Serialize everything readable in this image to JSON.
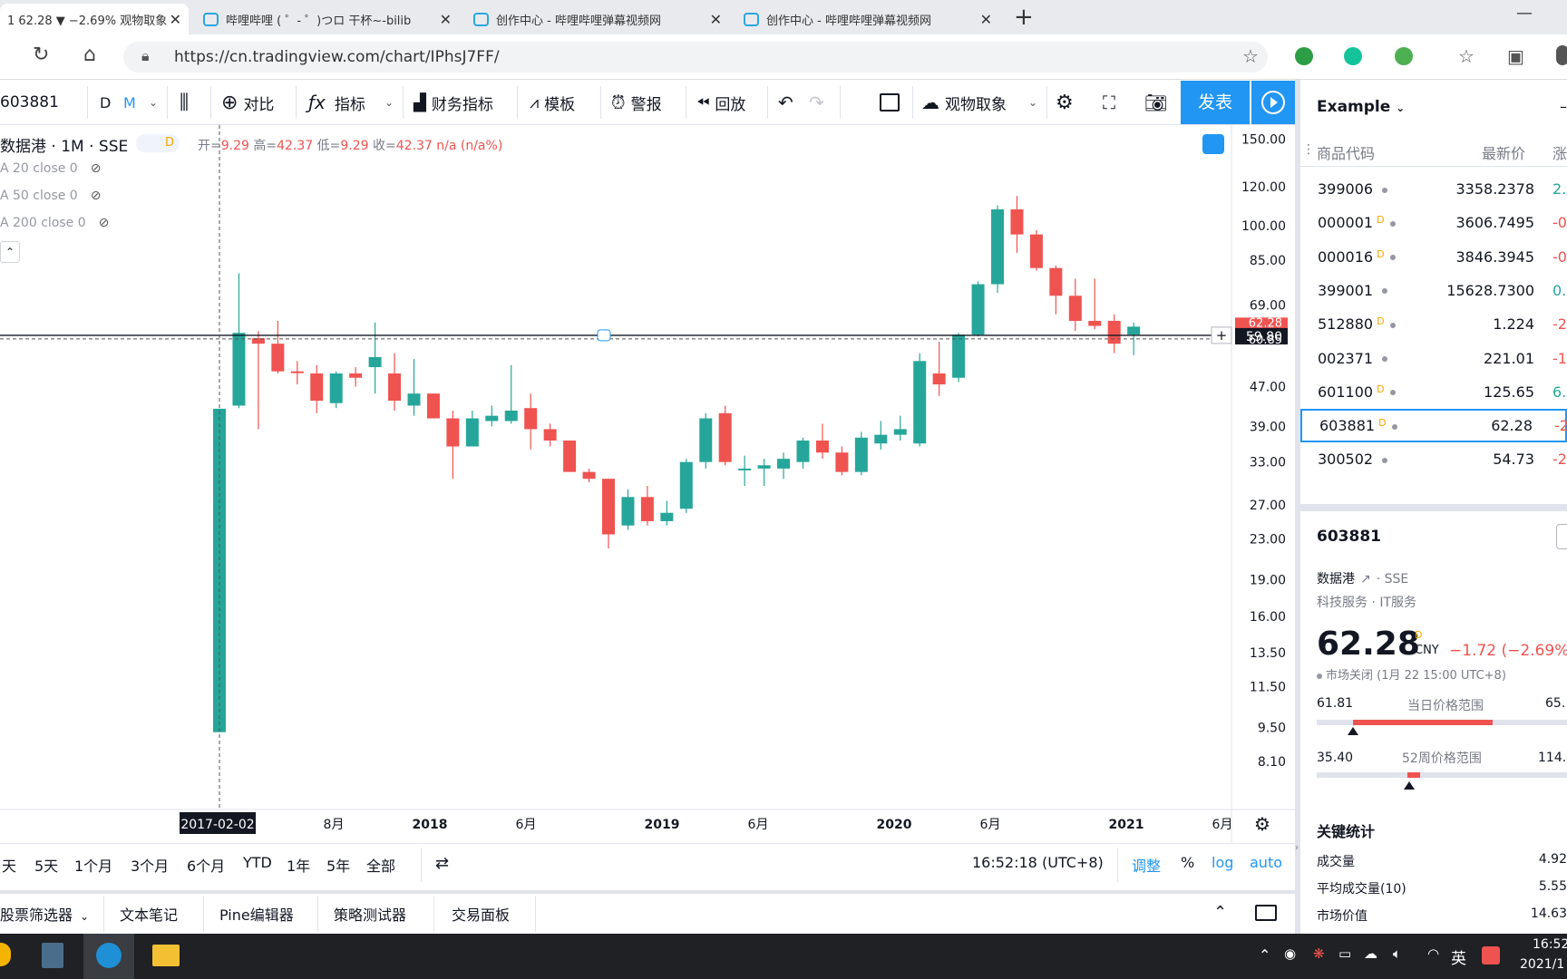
{
  "browser": {
    "tabs": [
      {
        "title": "1 62.28 ▼ −2.69% 观物取象"
      },
      {
        "title": "哔哩哔哩 ( ゜- ゜)つロ 干杯~-bilib"
      },
      {
        "title": "创作中心 - 哔哩哔哩弹幕视频网"
      },
      {
        "title": "创作中心 - 哔哩哔哩弹幕视频网"
      }
    ],
    "new_tab": "+",
    "url": "https://cn.tradingview.com/chart/IPhsJ7FF/"
  },
  "toolbar": {
    "symbol": "603881",
    "interval_d": "D",
    "interval_m": "M",
    "compare": "对比",
    "indicators": "指标",
    "financials": "财务指标",
    "templates": "模板",
    "alerts": "警报",
    "replay": "回放",
    "layout_name": "观物取象",
    "publish": "发表"
  },
  "chart_header": {
    "title": "数据港 · 1M · SSE",
    "d_badge": "D",
    "ohlc_open_label": "开=",
    "ohlc_open": "9.29",
    "ohlc_high_label": "高=",
    "ohlc_high": "42.37",
    "ohlc_low_label": "低=",
    "ohlc_low": "9.29",
    "ohlc_close_label": "收=",
    "ohlc_close": "42.37 n/a (n/a%)",
    "indicators": [
      "A 20 close 0",
      "A 50 close 0",
      "A 200 close 0"
    ]
  },
  "chart_data": {
    "type": "candlestick",
    "title": "数据港 · 1M · SSE",
    "log_scale": true,
    "ylim": [
      7.5,
      155
    ],
    "y_ticks": [
      150.0,
      120.0,
      100.0,
      85.0,
      69.0,
      47.0,
      39.0,
      33.0,
      27.0,
      23.0,
      19.0,
      16.0,
      13.5,
      11.5,
      9.5,
      8.1
    ],
    "x_labels": [
      "2017-02-02",
      "8月",
      "2018",
      "6月",
      "2019",
      "6月",
      "2020",
      "6月",
      "2021",
      "6月"
    ],
    "crosshair_price": "59.80",
    "last_price_label": "62.28",
    "prev_close_label": "60.85",
    "candles": [
      {
        "o": 9.29,
        "h": 42.37,
        "l": 9.29,
        "c": 42.37
      },
      {
        "o": 43.0,
        "h": 80.0,
        "l": 42.5,
        "c": 60.5
      },
      {
        "o": 59.0,
        "h": 61.0,
        "l": 38.5,
        "c": 57.5
      },
      {
        "o": 57.5,
        "h": 64.0,
        "l": 50.0,
        "c": 50.5
      },
      {
        "o": 50.5,
        "h": 53.0,
        "l": 47.5,
        "c": 50.3
      },
      {
        "o": 50.0,
        "h": 52.0,
        "l": 41.5,
        "c": 44.0
      },
      {
        "o": 43.5,
        "h": 50.5,
        "l": 42.5,
        "c": 50.0
      },
      {
        "o": 50.0,
        "h": 51.5,
        "l": 47.0,
        "c": 49.0
      },
      {
        "o": 51.5,
        "h": 63.5,
        "l": 45.5,
        "c": 54.0
      },
      {
        "o": 50.0,
        "h": 55.0,
        "l": 42.0,
        "c": 44.0
      },
      {
        "o": 43.0,
        "h": 53.5,
        "l": 41.0,
        "c": 45.5
      },
      {
        "o": 45.5,
        "h": 45.5,
        "l": 40.5,
        "c": 40.5
      },
      {
        "o": 40.5,
        "h": 42.0,
        "l": 30.5,
        "c": 35.5
      },
      {
        "o": 35.5,
        "h": 42.0,
        "l": 35.5,
        "c": 40.5
      },
      {
        "o": 40.0,
        "h": 43.0,
        "l": 39.0,
        "c": 41.0
      },
      {
        "o": 40.0,
        "h": 52.0,
        "l": 39.5,
        "c": 42.0
      },
      {
        "o": 42.5,
        "h": 45.5,
        "l": 35.0,
        "c": 38.5
      },
      {
        "o": 38.5,
        "h": 39.5,
        "l": 35.5,
        "c": 36.5
      },
      {
        "o": 36.5,
        "h": 36.5,
        "l": 31.5,
        "c": 31.5
      },
      {
        "o": 31.5,
        "h": 32.0,
        "l": 30.0,
        "c": 30.5
      },
      {
        "o": 30.5,
        "h": 30.5,
        "l": 22.0,
        "c": 23.5
      },
      {
        "o": 24.5,
        "h": 29.0,
        "l": 24.0,
        "c": 28.0
      },
      {
        "o": 28.0,
        "h": 29.5,
        "l": 24.5,
        "c": 25.0
      },
      {
        "o": 25.0,
        "h": 27.5,
        "l": 24.5,
        "c": 26.0
      },
      {
        "o": 26.5,
        "h": 33.5,
        "l": 26.0,
        "c": 33.0
      },
      {
        "o": 33.0,
        "h": 41.5,
        "l": 32.0,
        "c": 40.5
      },
      {
        "o": 41.5,
        "h": 43.0,
        "l": 32.5,
        "c": 33.0
      },
      {
        "o": 32.0,
        "h": 34.0,
        "l": 29.5,
        "c": 32.0
      },
      {
        "o": 32.0,
        "h": 33.5,
        "l": 29.5,
        "c": 32.5
      },
      {
        "o": 32.0,
        "h": 34.5,
        "l": 30.5,
        "c": 33.5
      },
      {
        "o": 33.0,
        "h": 37.0,
        "l": 32.0,
        "c": 36.5
      },
      {
        "o": 36.5,
        "h": 39.5,
        "l": 33.5,
        "c": 34.5
      },
      {
        "o": 34.5,
        "h": 35.5,
        "l": 31.0,
        "c": 31.5
      },
      {
        "o": 31.5,
        "h": 38.0,
        "l": 31.0,
        "c": 37.0
      },
      {
        "o": 36.0,
        "h": 40.0,
        "l": 35.0,
        "c": 37.5
      },
      {
        "o": 37.5,
        "h": 41.0,
        "l": 36.5,
        "c": 38.5
      },
      {
        "o": 36.0,
        "h": 55.0,
        "l": 35.5,
        "c": 53.0
      },
      {
        "o": 50.0,
        "h": 58.0,
        "l": 45.0,
        "c": 47.5
      },
      {
        "o": 49.0,
        "h": 60.5,
        "l": 48.0,
        "c": 60.0
      },
      {
        "o": 60.0,
        "h": 77.0,
        "l": 59.5,
        "c": 76.0
      },
      {
        "o": 76.0,
        "h": 110.0,
        "l": 73.0,
        "c": 108.0
      },
      {
        "o": 108.0,
        "h": 115.0,
        "l": 88.0,
        "c": 96.0
      },
      {
        "o": 96.0,
        "h": 98.0,
        "l": 81.0,
        "c": 82.0
      },
      {
        "o": 82.0,
        "h": 83.0,
        "l": 66.0,
        "c": 72.0
      },
      {
        "o": 72.0,
        "h": 78.0,
        "l": 61.0,
        "c": 64.0
      },
      {
        "o": 64.0,
        "h": 78.0,
        "l": 61.5,
        "c": 62.5
      },
      {
        "o": 64.0,
        "h": 66.0,
        "l": 55.0,
        "c": 57.5
      },
      {
        "o": 60.0,
        "h": 63.5,
        "l": 54.5,
        "c": 62.28
      }
    ]
  },
  "range_bar": {
    "ranges": [
      "天",
      "5天",
      "1个月",
      "3个月",
      "6个月",
      "YTD",
      "1年",
      "5年",
      "全部"
    ],
    "time": "16:52:18 (UTC+8)",
    "adjust": "调整",
    "percent": "%",
    "log": "log",
    "auto": "auto"
  },
  "bottom_tabs": [
    "股票筛选器",
    "文本笔记",
    "Pine编辑器",
    "策略测试器",
    "交易面板"
  ],
  "watchlist": {
    "name": "Example",
    "col_symbol": "商品代码",
    "col_price": "最新价",
    "col_change": "涨",
    "rows": [
      {
        "sym": "399006",
        "d": "",
        "price": "3358.2378",
        "chg": "2.",
        "color": "#26a69a"
      },
      {
        "sym": "000001",
        "d": "D",
        "price": "3606.7495",
        "chg": "-0.",
        "color": "#ef5350"
      },
      {
        "sym": "000016",
        "d": "D",
        "price": "3846.3945",
        "chg": "-0.",
        "color": "#ef5350"
      },
      {
        "sym": "399001",
        "d": "",
        "price": "15628.7300",
        "chg": "0.",
        "color": "#26a69a"
      },
      {
        "sym": "512880",
        "d": "D",
        "price": "1.224",
        "chg": "-2.",
        "color": "#ef5350"
      },
      {
        "sym": "002371",
        "d": "",
        "price": "221.01",
        "chg": "-1.",
        "color": "#ef5350"
      },
      {
        "sym": "601100",
        "d": "D",
        "price": "125.65",
        "chg": "6.",
        "color": "#26a69a"
      },
      {
        "sym": "603881",
        "d": "D",
        "price": "62.28",
        "chg": "-2.",
        "color": "#ef5350"
      },
      {
        "sym": "300502",
        "d": "",
        "price": "54.73",
        "chg": "-2.",
        "color": "#ef5350"
      }
    ]
  },
  "details": {
    "symbol": "603881",
    "name": "数据港",
    "exchange": "SSE",
    "sector": "科技服务",
    "industry": "IT服务",
    "price": "62.28",
    "d_badge": "D",
    "currency": "CNY",
    "change": "−1.72 (−2.69%)",
    "status": "市场关闭 (1月 22 15:00 UTC+8)",
    "day_low": "61.81",
    "day_range_label": "当日价格范围",
    "day_high": "65.",
    "day_range_fill": 0.78,
    "week_low": "35.40",
    "week_range_label": "52周价格范围",
    "week_high": "114.",
    "week_range_fill": 0.34,
    "key_stats": "关键统计",
    "stats": [
      {
        "label": "成交量",
        "value": "4.92"
      },
      {
        "label": "平均成交量(10)",
        "value": "5.55"
      },
      {
        "label": "市场价值",
        "value": "14.63"
      }
    ]
  },
  "taskbar": {
    "tray_lang": "英",
    "clock_time": "16:52",
    "clock_date": "2021/1"
  },
  "colors": {
    "up": "#26a69a",
    "down": "#ef5350",
    "accent": "#2196f3"
  }
}
